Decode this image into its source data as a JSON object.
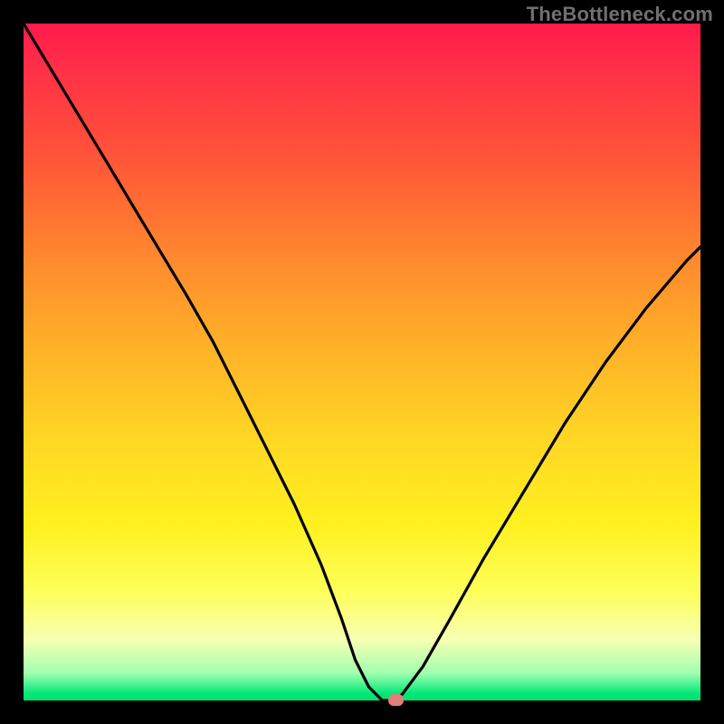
{
  "watermark": "TheBottleneck.com",
  "domain": "Chart",
  "chart_data": {
    "type": "line",
    "title": "",
    "xlabel": "",
    "ylabel": "",
    "xlim": [
      0,
      100
    ],
    "ylim": [
      0,
      100
    ],
    "grid": false,
    "legend": false,
    "background_gradient": {
      "direction": "vertical",
      "stops": [
        {
          "pos": 0,
          "color": "#ff1a4a"
        },
        {
          "pos": 20,
          "color": "#ff5538"
        },
        {
          "pos": 48,
          "color": "#ffb228"
        },
        {
          "pos": 74,
          "color": "#fff020"
        },
        {
          "pos": 91,
          "color": "#f8ffb2"
        },
        {
          "pos": 100,
          "color": "#00e070"
        }
      ]
    },
    "series": [
      {
        "name": "bottleneck-curve",
        "color": "#000000",
        "x": [
          0,
          6,
          12,
          18,
          24,
          28,
          32,
          36,
          40,
          44,
          47,
          49,
          51,
          53,
          55,
          56,
          59,
          63,
          68,
          74,
          80,
          86,
          92,
          98,
          100
        ],
        "values": [
          100,
          90,
          80,
          70,
          60,
          53,
          45,
          37,
          29,
          20,
          12,
          6,
          2,
          0,
          0,
          1,
          5,
          12,
          21,
          31,
          41,
          50,
          58,
          65,
          67
        ]
      }
    ],
    "marker": {
      "name": "bottleneck-point",
      "x": 55,
      "y": 0,
      "color": "#e27e7c",
      "shape": "rounded-rect"
    },
    "note": "Values are read off the image; x and y are in percent of plot area (0 = left/bottom, 100 = right/top)."
  }
}
